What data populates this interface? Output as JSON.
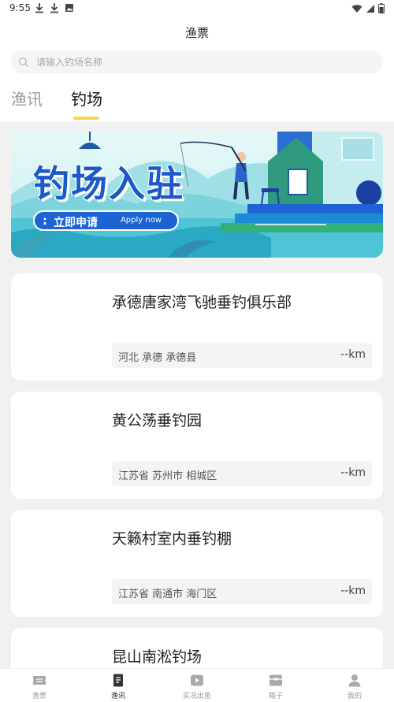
{
  "status_bar": {
    "time": "9:55",
    "left_icons": [
      "download-icon",
      "download-icon",
      "photo-notification-icon"
    ],
    "right_icons": [
      "wifi-icon",
      "signal-icon",
      "battery-icon"
    ]
  },
  "header": {
    "title": "渔票",
    "search_placeholder": "请输入钓场名称",
    "tabs": [
      {
        "label": "渔讯",
        "active": false
      },
      {
        "label": "钓场",
        "active": true
      }
    ],
    "accent_color": "#f7d64a"
  },
  "banner": {
    "title": "钓场入驻",
    "cta_label": "立即申请",
    "cta_en": "Apply now",
    "brand_color": "#1d63d4"
  },
  "venues": [
    {
      "name": "承德唐家湾飞驰垂钓俱乐部",
      "region": "河北 承德 承德县",
      "distance": "--km"
    },
    {
      "name": "黄公荡垂钓园",
      "region": "江苏省 苏州市 相城区",
      "distance": "--km"
    },
    {
      "name": "天籁村室内垂钓棚",
      "region": "江苏省 南通市 海门区",
      "distance": "--km"
    },
    {
      "name": "昆山南淞钓场",
      "region": "",
      "distance": ""
    }
  ],
  "tabbar": {
    "items": [
      {
        "label": "渔票",
        "icon": "ticket-icon",
        "active": false
      },
      {
        "label": "渔讯",
        "icon": "document-icon",
        "active": true
      },
      {
        "label": "实况出鱼",
        "icon": "video-icon",
        "active": false
      },
      {
        "label": "箱子",
        "icon": "box-icon",
        "active": false
      },
      {
        "label": "我的",
        "icon": "person-icon",
        "active": false
      }
    ]
  }
}
